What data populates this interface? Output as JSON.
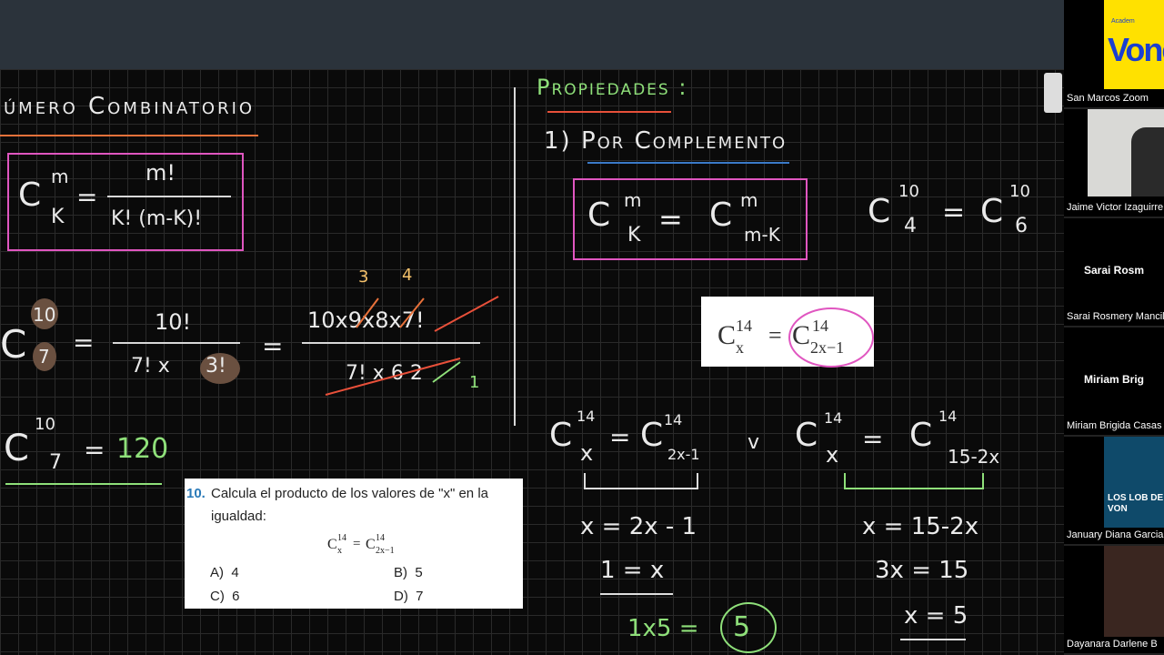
{
  "board": {
    "title_left": "úmero Combinatorio",
    "def_formula": {
      "C": "C",
      "m_sup": "m",
      "k_sub": "K",
      "eq": "=",
      "num": "m!",
      "den": "K!  (m-K)!"
    },
    "example": {
      "c": "C",
      "sup": "10",
      "sub": "7",
      "eq1": "=",
      "num1": "10!",
      "den1a": "7!  x",
      "den1b": "3!",
      "eq2": "=",
      "num2": "10x9x8x7!",
      "den2": "7! x 6 2",
      "marks_top": [
        "3",
        "4"
      ],
      "mark_one": "1"
    },
    "result": {
      "c": "C",
      "sup": "10",
      "sub": "7",
      "eq": "=",
      "value": "120"
    },
    "properties_title": "Propiedades :",
    "prop1_label": "1) Por Complemento",
    "prop_formula": {
      "c1": "C",
      "m1": "m",
      "k1": "K",
      "eq": "=",
      "c2": "C",
      "m2": "m",
      "mk": "m-K"
    },
    "prop_example": {
      "c1": "C",
      "s1": "10",
      "b1": "4",
      "eq": "=",
      "c2": "C",
      "s2": "10",
      "b2": "6"
    },
    "prop_image": {
      "c1": "C",
      "s1": "14",
      "b1": "x",
      "eq": "=",
      "c2": "C",
      "s2": "14",
      "b2": "2x−1"
    },
    "solution": {
      "left_eq": {
        "c1": "C",
        "s1": "14",
        "b1": "x",
        "eq": "=",
        "c2": "C",
        "s2": "14",
        "b2": "2x-1"
      },
      "or": "v",
      "right_eq": {
        "c1": "C",
        "s1": "14",
        "b1": "x",
        "eq": "=",
        "c2": "C",
        "s2": "14",
        "b2": "15-2x"
      },
      "left_steps": [
        "x = 2x - 1",
        "1 = x"
      ],
      "right_steps": [
        "x = 15-2x",
        "3x = 15",
        "x = 5"
      ],
      "product": "1x5 =",
      "answer": "5"
    },
    "exercise": {
      "number": "10.",
      "text_line1": "Calcula el producto de los valores de \"x\" en la",
      "text_line2": "igualdad:",
      "formula": {
        "c1": "C",
        "s1": "14",
        "b1": "x",
        "eq": "=",
        "c2": "C",
        "s2": "14",
        "b2": "2x−1"
      },
      "options": [
        {
          "letter": "A)",
          "value": "4"
        },
        {
          "letter": "B)",
          "value": "5"
        },
        {
          "letter": "C)",
          "value": "6"
        },
        {
          "letter": "D)",
          "value": "7"
        }
      ]
    }
  },
  "participants": [
    {
      "name": "San Marcos Zoom",
      "label": ""
    },
    {
      "name": "Jaime Victor Izaguirre",
      "label": ""
    },
    {
      "name": "Sarai Rosmery Mancilla",
      "label": "Sarai Rosm"
    },
    {
      "name": "Miriam Brigida Casas",
      "label": "Miriam Brig"
    },
    {
      "name": "January Diana Garcia",
      "label": ""
    },
    {
      "name": "Dayanara Darlene B",
      "label": ""
    }
  ],
  "logo_text": "Vone",
  "logo_small": "Academ",
  "banner_text": "LOS LOB DE VON",
  "colors": {
    "pink": "#e056c0",
    "green": "#8fe07a",
    "orange": "#f6c26b",
    "topbar": "#2b333b",
    "logo_yellow": "#ffe100",
    "logo_blue": "#1a3fd1"
  }
}
